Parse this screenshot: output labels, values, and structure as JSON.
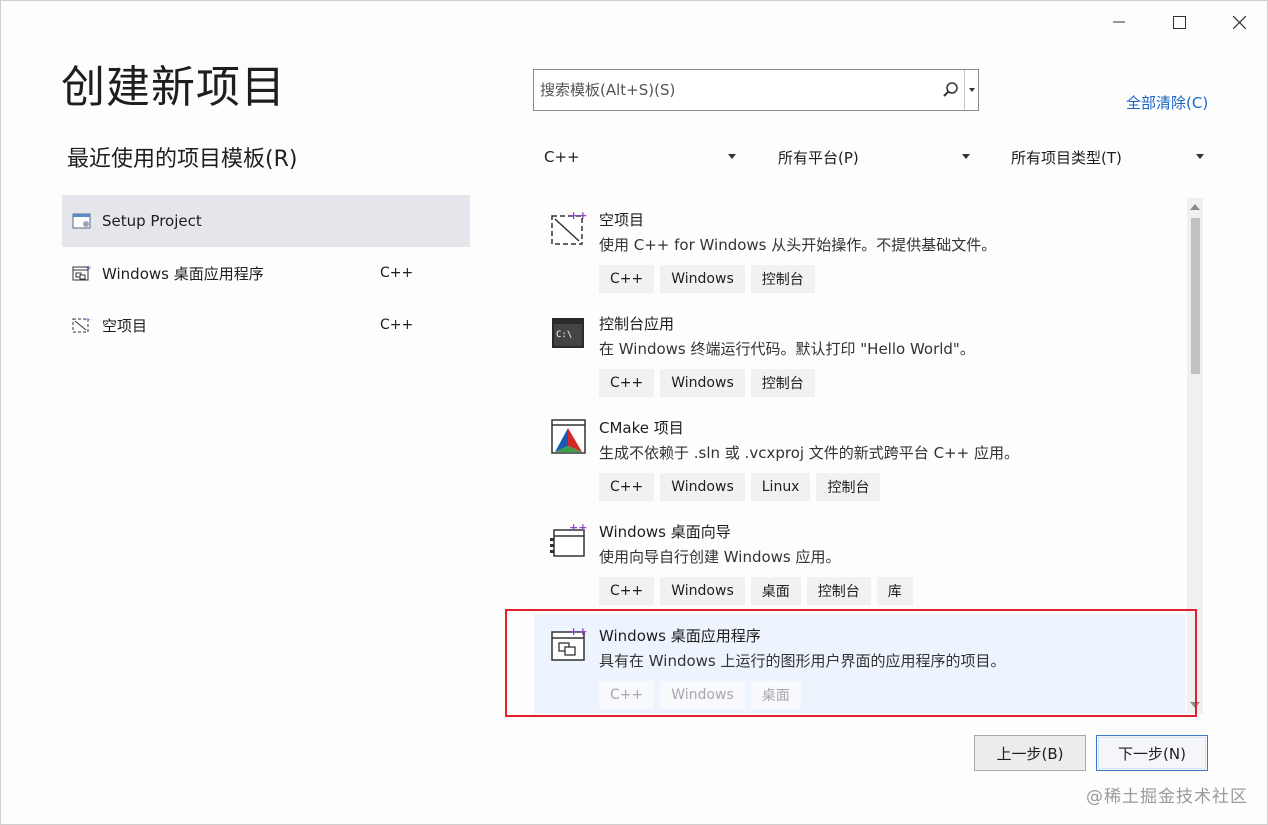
{
  "window": {
    "controls": {
      "minimize_icon": "minimize-icon",
      "maximize_icon": "maximize-icon",
      "close_icon": "close-icon"
    }
  },
  "page_title": "创建新项目",
  "recent": {
    "title": "最近使用的项目模板(R)",
    "items": [
      {
        "label": "Setup Project",
        "lang": "",
        "icon": "setup-project-icon",
        "selected": true
      },
      {
        "label": "Windows 桌面应用程序",
        "lang": "C++",
        "icon": "windows-desktop-app-icon",
        "selected": false
      },
      {
        "label": "空项目",
        "lang": "C++",
        "icon": "empty-project-icon",
        "selected": false
      }
    ]
  },
  "search": {
    "placeholder": "搜索模板(Alt+S)(S)",
    "value": ""
  },
  "clear_all": "全部清除(C)",
  "filters": {
    "language": "C++",
    "platform": "所有平台(P)",
    "project_type": "所有项目类型(T)"
  },
  "templates": [
    {
      "name": "空项目",
      "desc": "使用 C++ for Windows 从头开始操作。不提供基础文件。",
      "tags": [
        "C++",
        "Windows",
        "控制台"
      ],
      "icon": "empty-project-icon"
    },
    {
      "name": "控制台应用",
      "desc": "在 Windows 终端运行代码。默认打印 \"Hello World\"。",
      "tags": [
        "C++",
        "Windows",
        "控制台"
      ],
      "icon": "console-app-icon"
    },
    {
      "name": "CMake 项目",
      "desc": "生成不依赖于 .sln 或 .vcxproj 文件的新式跨平台 C++ 应用。",
      "tags": [
        "C++",
        "Windows",
        "Linux",
        "控制台"
      ],
      "icon": "cmake-icon"
    },
    {
      "name": "Windows 桌面向导",
      "desc": "使用向导自行创建 Windows 应用。",
      "tags": [
        "C++",
        "Windows",
        "桌面",
        "控制台",
        "库"
      ],
      "icon": "desktop-wizard-icon"
    },
    {
      "name": "Windows 桌面应用程序",
      "desc": "具有在 Windows 上运行的图形用户界面的应用程序的项目。",
      "tags": [
        "C++",
        "Windows",
        "桌面"
      ],
      "icon": "windows-desktop-app-icon",
      "selected": true
    }
  ],
  "buttons": {
    "back": "上一步(B)",
    "next": "下一步(N)"
  },
  "watermark": "@稀土掘金技术社区",
  "colors": {
    "accent_link": "#1a64c8",
    "highlight_border": "#e0202a",
    "selected_bg": "#e4e6ec"
  }
}
